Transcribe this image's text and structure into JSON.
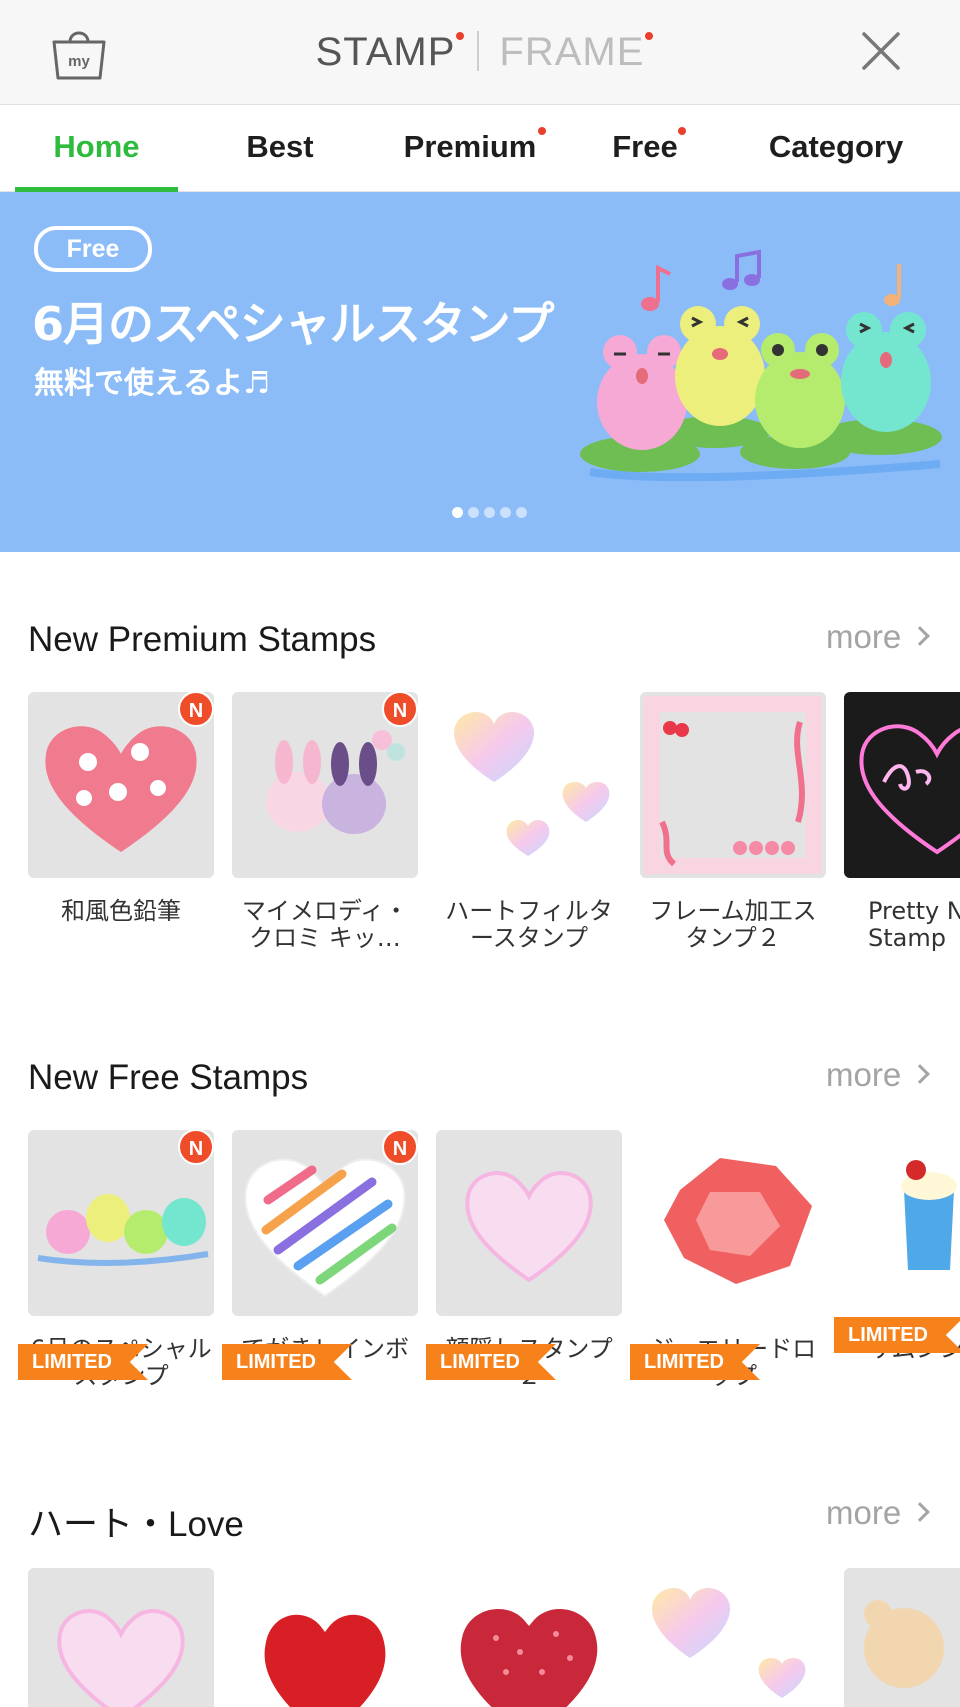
{
  "header": {
    "my_label": "my",
    "modes": [
      {
        "label": "STAMP",
        "active": true,
        "has_dot": true
      },
      {
        "label": "FRAME",
        "active": false,
        "has_dot": true
      }
    ],
    "close_icon": "close-icon"
  },
  "tabs": [
    {
      "label": "Home",
      "active": true,
      "has_dot": false
    },
    {
      "label": "Best",
      "active": false,
      "has_dot": false
    },
    {
      "label": "Premium",
      "active": false,
      "has_dot": true
    },
    {
      "label": "Free",
      "active": false,
      "has_dot": true
    },
    {
      "label": "Category",
      "active": false,
      "has_dot": false
    }
  ],
  "banner": {
    "pill": "Free",
    "title": "6月のスペシャルスタンプ",
    "subtitle": "無料で使えるよ♬",
    "page_count": 5,
    "current_page": 1
  },
  "sections": [
    {
      "title": "New Premium Stamps",
      "more": "more",
      "items": [
        {
          "name": "和風色鉛筆",
          "badge": "N",
          "limited": ""
        },
        {
          "name": "マイメロディ・クロミ キッ…",
          "badge": "N",
          "limited": ""
        },
        {
          "name": "ハートフィルタースタンプ",
          "badge": "",
          "limited": ""
        },
        {
          "name": "フレーム加工スタンプ２",
          "badge": "",
          "limited": ""
        },
        {
          "name": "Pretty N Stamp",
          "badge": "",
          "limited": ""
        }
      ]
    },
    {
      "title": "New Free Stamps",
      "more": "more",
      "items": [
        {
          "name": "6月のスペシャルスタンプ",
          "badge": "N",
          "limited": "LIMITED"
        },
        {
          "name": "てがきレインボー",
          "badge": "N",
          "limited": "LIMITED"
        },
        {
          "name": "顔隠しスタンプ２",
          "badge": "",
          "limited": "LIMITED"
        },
        {
          "name": "ジュエリードロップ",
          "badge": "",
          "limited": "LIMITED"
        },
        {
          "name": "サムシング ー",
          "badge": "",
          "limited": "LIMITED"
        }
      ]
    },
    {
      "title": "ハート・Love",
      "more": "more",
      "items": []
    }
  ],
  "colors": {
    "accent": "#2fbc3e",
    "badge": "#ef4d2a",
    "limited": "#f7821b",
    "banner": "#8bbcf8"
  }
}
